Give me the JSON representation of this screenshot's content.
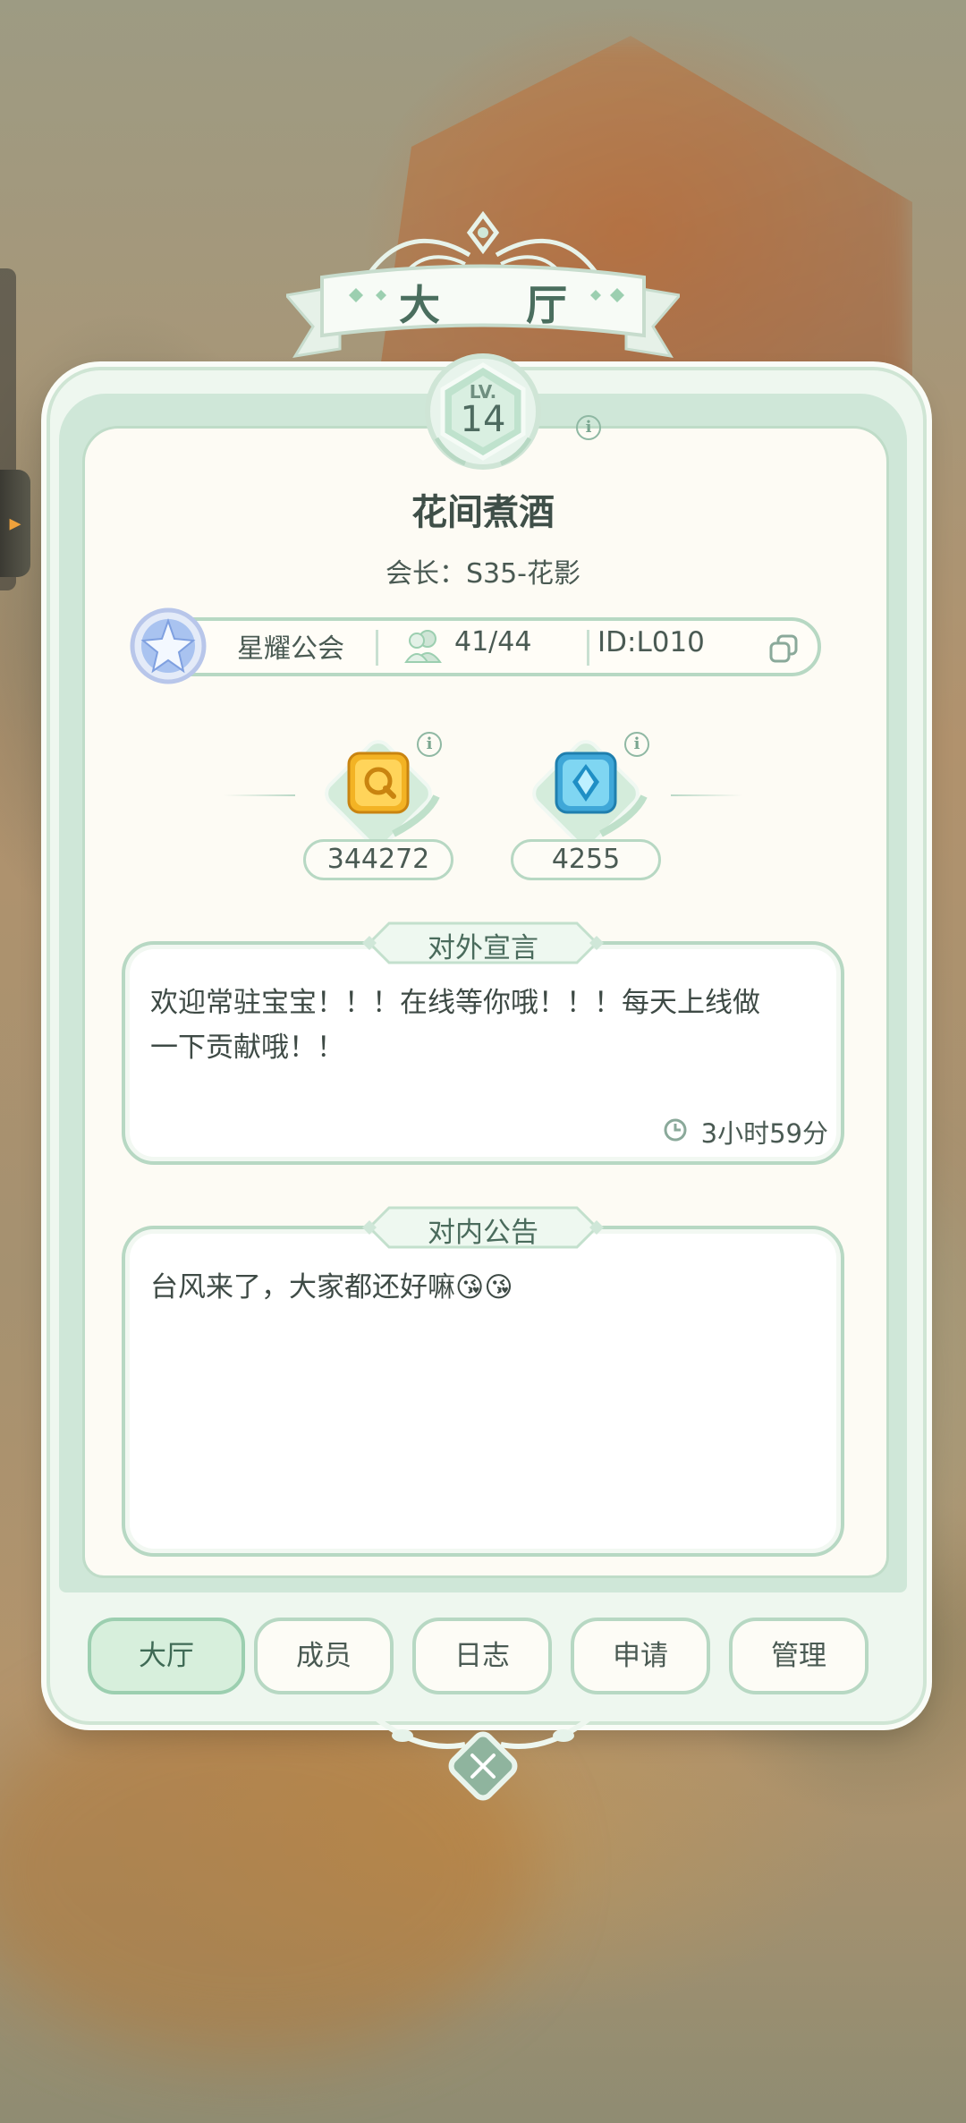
{
  "header": {
    "title": "大 厅",
    "level_label": "LV.",
    "level": "14"
  },
  "guild": {
    "name": "花间煮酒",
    "leader_line": "会长：S35-花影",
    "type": "星耀公会",
    "members": "41/44",
    "id": "ID:L010"
  },
  "resources": [
    {
      "icon": "gold-token-icon",
      "value": "344272"
    },
    {
      "icon": "blue-crystal-icon",
      "value": "4255"
    }
  ],
  "external_notice": {
    "label": "对外宣言",
    "text_line1": "欢迎常驻宝宝！！！在线等你哦！！！每天上线做",
    "text_line2": "一下贡献哦！！",
    "time": "3小时59分"
  },
  "internal_notice": {
    "label": "对内公告",
    "text": "台风来了，大家都还好嘛😘😘"
  },
  "tabs": [
    {
      "label": "大厅",
      "active": true
    },
    {
      "label": "成员",
      "active": false
    },
    {
      "label": "日志",
      "active": false
    },
    {
      "label": "申请",
      "active": false
    },
    {
      "label": "管理",
      "active": false
    }
  ],
  "colors": {
    "accent": "#b7d8c3",
    "panel": "#fdfbf4",
    "text": "#4a5a53"
  }
}
